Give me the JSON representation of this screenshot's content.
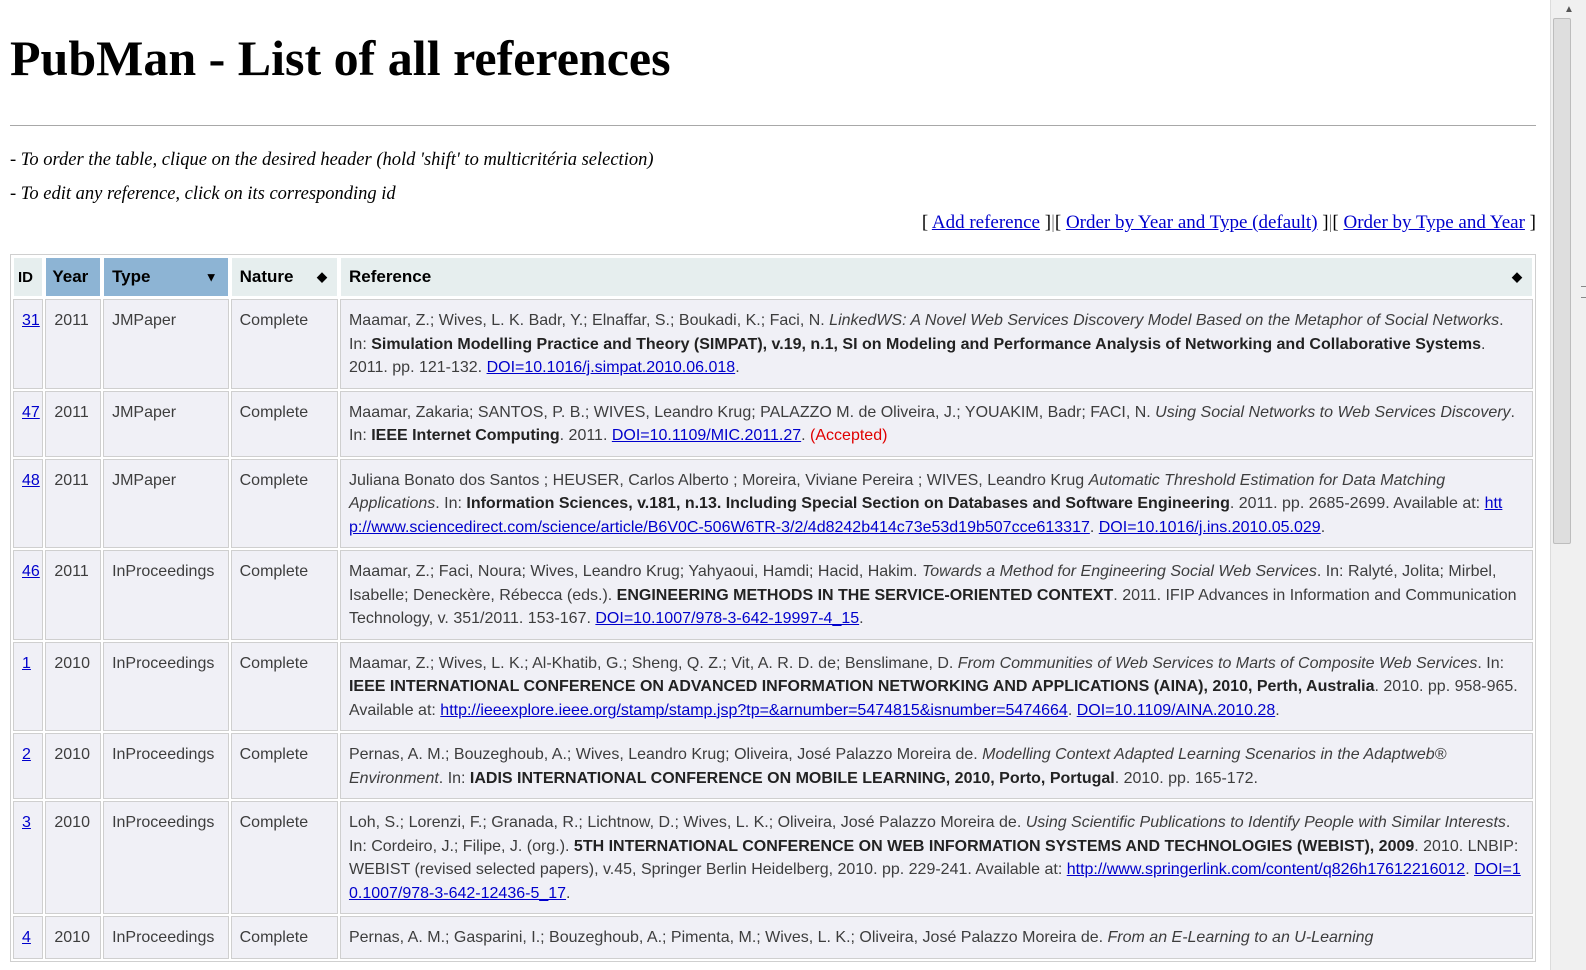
{
  "page": {
    "title": "PubMan - List of all references",
    "instructions": [
      "- To order the table, clique on the desired header (hold 'shift' to multicritéria selection)",
      "- To edit any reference, click on its corresponding id"
    ],
    "actions": {
      "add": "Add reference",
      "order_year_type": "Order by Year and Type (default)",
      "order_type_year": "Order by Type and Year"
    }
  },
  "table": {
    "columns": {
      "id": "ID",
      "year": "Year",
      "type": "Type",
      "nature": "Nature",
      "reference": "Reference"
    },
    "rows": [
      {
        "id": "31",
        "year": "2011",
        "type": "JMPaper",
        "nature": "Complete",
        "authors": "Maamar, Z.; Wives, L. K. Badr, Y.; Elnaffar, S.; Boukadi, K.; Faci, N. ",
        "title": "LinkedWS: A Novel Web Services Discovery Model Based on the Metaphor of Social Networks",
        "in_pre": ". In: ",
        "venue": "Simulation Modelling Practice and Theory (SIMPAT), v.19, n.1, SI on Modeling and Performance Analysis of Networking and Collaborative Systems",
        "details": ". 2011. pp. 121-132. ",
        "url_pre": "",
        "url": "",
        "doi": "DOI=10.1016/j.simpat.2010.06.018",
        "tail": ".",
        "note": "",
        "after": ""
      },
      {
        "id": "47",
        "year": "2011",
        "type": "JMPaper",
        "nature": "Complete",
        "authors": "Maamar, Zakaria; SANTOS, P. B.; WIVES, Leandro Krug; PALAZZO M. de Oliveira, J.; YOUAKIM, Badr; FACI, N. ",
        "title": "Using Social Networks to Web Services Discovery",
        "in_pre": ". In: ",
        "venue": "IEEE Internet Computing",
        "details": ". 2011. ",
        "url_pre": "",
        "url": "",
        "doi": "DOI=10.1109/MIC.2011.27",
        "tail": ". ",
        "note": "(Accepted)",
        "after": ""
      },
      {
        "id": "48",
        "year": "2011",
        "type": "JMPaper",
        "nature": "Complete",
        "authors": "Juliana Bonato dos Santos ; HEUSER, Carlos Alberto ; Moreira, Viviane Pereira ; WIVES, Leandro Krug ",
        "title": "Automatic Threshold Estimation for Data Matching Applications",
        "in_pre": ". In: ",
        "venue": "Information Sciences, v.181, n.13. Including Special Section on Databases and Software Engineering",
        "details": ". 2011. pp. 2685-2699. ",
        "url_pre": "Available at: ",
        "url": "http://www.sciencedirect.com/science/article/B6V0C-506W6TR-3/2/4d8242b414c73e53d19b507cce613317",
        "doi": "DOI=10.1016/j.ins.2010.05.029",
        "tail": ".",
        "note": "",
        "after": ""
      },
      {
        "id": "46",
        "year": "2011",
        "type": "InProceedings",
        "nature": "Complete",
        "authors": "Maamar, Z.; Faci, Noura; Wives, Leandro Krug; Yahyaoui, Hamdi; Hacid, Hakim. ",
        "title": "Towards a Method for Engineering Social Web Services",
        "in_pre": ". In: Ralyté, Jolita; Mirbel, Isabelle; Deneckère, Rébecca (eds.). ",
        "venue": "ENGINEERING METHODS IN THE SERVICE-ORIENTED CONTEXT",
        "details": ". 2011. IFIP Advances in Information and Communication Technology, v. 351/2011. 153-167. ",
        "url_pre": "",
        "url": "",
        "doi": "DOI=10.1007/978-3-642-19997-4_15",
        "tail": ".",
        "note": "",
        "after": ""
      },
      {
        "id": "1",
        "year": "2010",
        "type": "InProceedings",
        "nature": "Complete",
        "authors": "Maamar, Z.; Wives, L. K.; Al-Khatib, G.; Sheng, Q. Z.; Vit, A. R. D. de; Benslimane, D. ",
        "title": "From Communities of Web Services to Marts of Composite Web Services",
        "in_pre": ". In: ",
        "venue": "IEEE INTERNATIONAL CONFERENCE ON ADVANCED INFORMATION NETWORKING AND APPLICATIONS (AINA), 2010, Perth, Australia",
        "details": ". 2010. pp. 958-965. ",
        "url_pre": "Available at: ",
        "url": "http://ieeexplore.ieee.org/stamp/stamp.jsp?tp=&arnumber=5474815&isnumber=5474664",
        "doi": "DOI=10.1109/AINA.2010.28",
        "tail": ".",
        "note": "",
        "after": ""
      },
      {
        "id": "2",
        "year": "2010",
        "type": "InProceedings",
        "nature": "Complete",
        "authors": "Pernas, A. M.; Bouzeghoub, A.; Wives, Leandro Krug; Oliveira, José Palazzo Moreira de. ",
        "title": "Modelling Context Adapted Learning Scenarios in the Adaptweb® Environment",
        "in_pre": ". In: ",
        "venue": "IADIS INTERNATIONAL CONFERENCE ON MOBILE LEARNING, 2010, Porto, Portugal",
        "details": ". 2010. pp. 165-172.",
        "url_pre": "",
        "url": "",
        "doi": "",
        "tail": "",
        "note": "",
        "after": ""
      },
      {
        "id": "3",
        "year": "2010",
        "type": "InProceedings",
        "nature": "Complete",
        "authors": "Loh, S.; Lorenzi, F.; Granada, R.; Lichtnow, D.; Wives, L. K.; Oliveira, José Palazzo Moreira de. ",
        "title": "Using Scientific Publications to Identify People with Similar Interests",
        "in_pre": ". In: Cordeiro, J.; Filipe, J. (org.). ",
        "venue": "5TH INTERNATIONAL CONFERENCE ON WEB INFORMATION SYSTEMS AND TECHNOLOGIES (WEBIST), 2009",
        "details": ". 2010. LNBIP: WEBIST (revised selected papers), v.45, Springer Berlin Heidelberg, 2010. pp. 229-241. ",
        "url_pre": "Available at: ",
        "url": "http://www.springerlink.com/content/q826h17612216012",
        "doi": "DOI=10.1007/978-3-642-12436-5_17",
        "tail": ".",
        "note": "",
        "after": ""
      },
      {
        "id": "4",
        "year": "2010",
        "type": "InProceedings",
        "nature": "Complete",
        "authors": "Pernas, A. M.; Gasparini, I.; Bouzeghoub, A.; Pimenta, M.; Wives, L. K.; Oliveira, José Palazzo Moreira de. ",
        "title": "From an E-Learning to an U-Learning",
        "in_pre": "",
        "venue": "",
        "details": "",
        "url_pre": "",
        "url": "",
        "doi": "",
        "tail": "",
        "note": "",
        "after": ""
      }
    ]
  },
  "icons": {
    "sort_both": "sort-arrows-icon",
    "sort_desc": "sort-desc-icon"
  }
}
